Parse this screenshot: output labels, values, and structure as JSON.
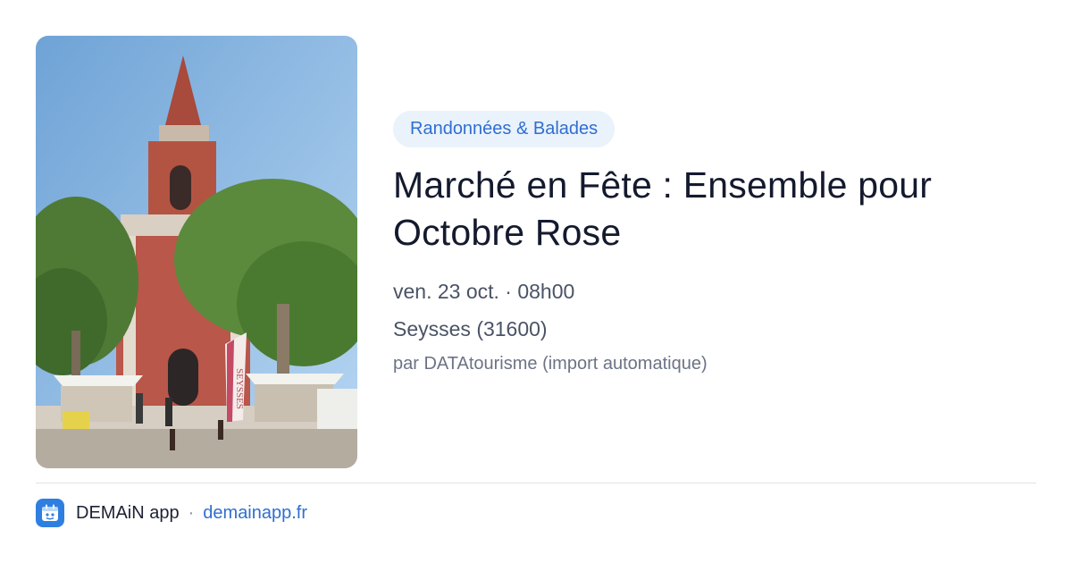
{
  "photo": {
    "icon": "church-market-photo",
    "banner_text": "SEYSSES"
  },
  "event": {
    "category": "Randonnées & Balades",
    "title": "Marché en Fête : Ensemble pour Octobre Rose",
    "datetime": "ven. 23 oct. · 08h00",
    "location": "Seysses (31600)",
    "source": "par DATAtourisme (import automatique)"
  },
  "footer": {
    "logo_icon": "demain-app-logo-icon",
    "app_name": "DEMAiN app",
    "separator": "·",
    "link_text": "demainapp.fr"
  },
  "colors": {
    "accent": "#2f6fd0",
    "badge_bg": "#eaf2fb",
    "title": "#141a2e",
    "meta": "#4a5366"
  }
}
